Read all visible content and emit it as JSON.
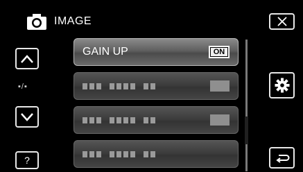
{
  "header": {
    "title": "IMAGE",
    "mode_icon": "camera-icon"
  },
  "nav": {
    "up_icon": "chevron-up-icon",
    "down_icon": "chevron-down-icon",
    "page_indicator": "▪/▪",
    "help_label": "?"
  },
  "menu": {
    "items": [
      {
        "label": "GAIN UP",
        "value": "ON",
        "state": "active"
      },
      {
        "label": "",
        "value": "",
        "state": "disabled"
      },
      {
        "label": "",
        "value": "",
        "state": "disabled"
      },
      {
        "label": "",
        "value": "",
        "state": "disabled"
      }
    ]
  },
  "right": {
    "close_icon": "close-icon",
    "settings_icon": "gear-icon",
    "back_icon": "return-icon"
  },
  "colors": {
    "background": "#000000",
    "button_border": "#e8e8e8",
    "active_item": "#6a6a6a",
    "disabled_item": "#3a3a3a"
  }
}
